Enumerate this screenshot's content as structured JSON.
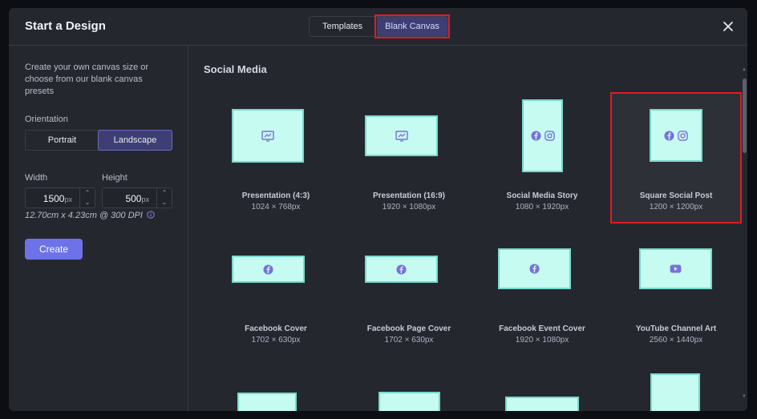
{
  "header": {
    "title": "Start a Design",
    "tabs": [
      {
        "label": "Templates"
      },
      {
        "label": "Blank Canvas"
      }
    ]
  },
  "left": {
    "intro": "Create your own canvas size or choose from our blank canvas presets",
    "orientation_label": "Orientation",
    "portrait": "Portrait",
    "landscape": "Landscape",
    "width_label": "Width",
    "height_label": "Height",
    "width_value": "1500",
    "height_value": "500",
    "unit": "px",
    "dpi_text": "12.70cm x 4.23cm @ 300 DPI",
    "create_label": "Create"
  },
  "right": {
    "section_title": "Social Media",
    "presets": [
      {
        "name": "Presentation (4:3)",
        "size": "1024 × 768px",
        "icon": "chart-icon"
      },
      {
        "name": "Presentation (16:9)",
        "size": "1920 × 1080px",
        "icon": "chart-icon"
      },
      {
        "name": "Social Media Story",
        "size": "1080 × 1920px",
        "icon": "facebook-instagram-icons"
      },
      {
        "name": "Square Social Post",
        "size": "1200 × 1200px",
        "icon": "facebook-instagram-icons"
      },
      {
        "name": "Facebook Cover",
        "size": "1702 × 630px",
        "icon": "facebook-icon"
      },
      {
        "name": "Facebook Page Cover",
        "size": "1702 × 630px",
        "icon": "facebook-icon"
      },
      {
        "name": "Facebook Event Cover",
        "size": "1920 × 1080px",
        "icon": "facebook-icon"
      },
      {
        "name": "YouTube Channel Art",
        "size": "2560 × 1440px",
        "icon": "youtube-icon"
      }
    ]
  },
  "colors": {
    "accent": "#6d72e8",
    "thumb_fill": "#c5fbf1",
    "thumb_border": "#77d9cc",
    "icon": "#7a6fd6",
    "highlight": "#e01b24"
  }
}
